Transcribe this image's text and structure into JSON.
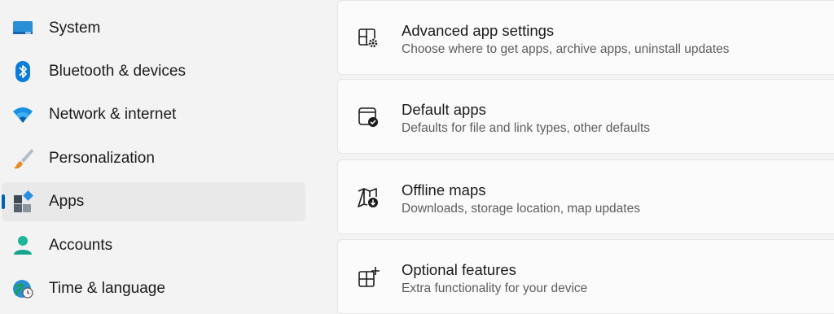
{
  "sidebar": {
    "items": [
      {
        "label": "System",
        "icon": "monitor-icon"
      },
      {
        "label": "Bluetooth & devices",
        "icon": "bluetooth-icon"
      },
      {
        "label": "Network & internet",
        "icon": "wifi-icon"
      },
      {
        "label": "Personalization",
        "icon": "paintbrush-icon"
      },
      {
        "label": "Apps",
        "icon": "apps-icon",
        "selected": true
      },
      {
        "label": "Accounts",
        "icon": "person-icon"
      },
      {
        "label": "Time & language",
        "icon": "globe-clock-icon"
      }
    ],
    "accent_color": "#005fb8"
  },
  "main": {
    "cards": [
      {
        "title": "Advanced app settings",
        "description": "Choose where to get apps, archive apps, uninstall updates",
        "icon": "app-settings-icon"
      },
      {
        "title": "Default apps",
        "description": "Defaults for file and link types, other defaults",
        "icon": "default-apps-icon"
      },
      {
        "title": "Offline maps",
        "description": "Downloads, storage location, map updates",
        "icon": "map-download-icon"
      },
      {
        "title": "Optional features",
        "description": "Extra functionality for your device",
        "icon": "grid-plus-icon"
      }
    ]
  }
}
